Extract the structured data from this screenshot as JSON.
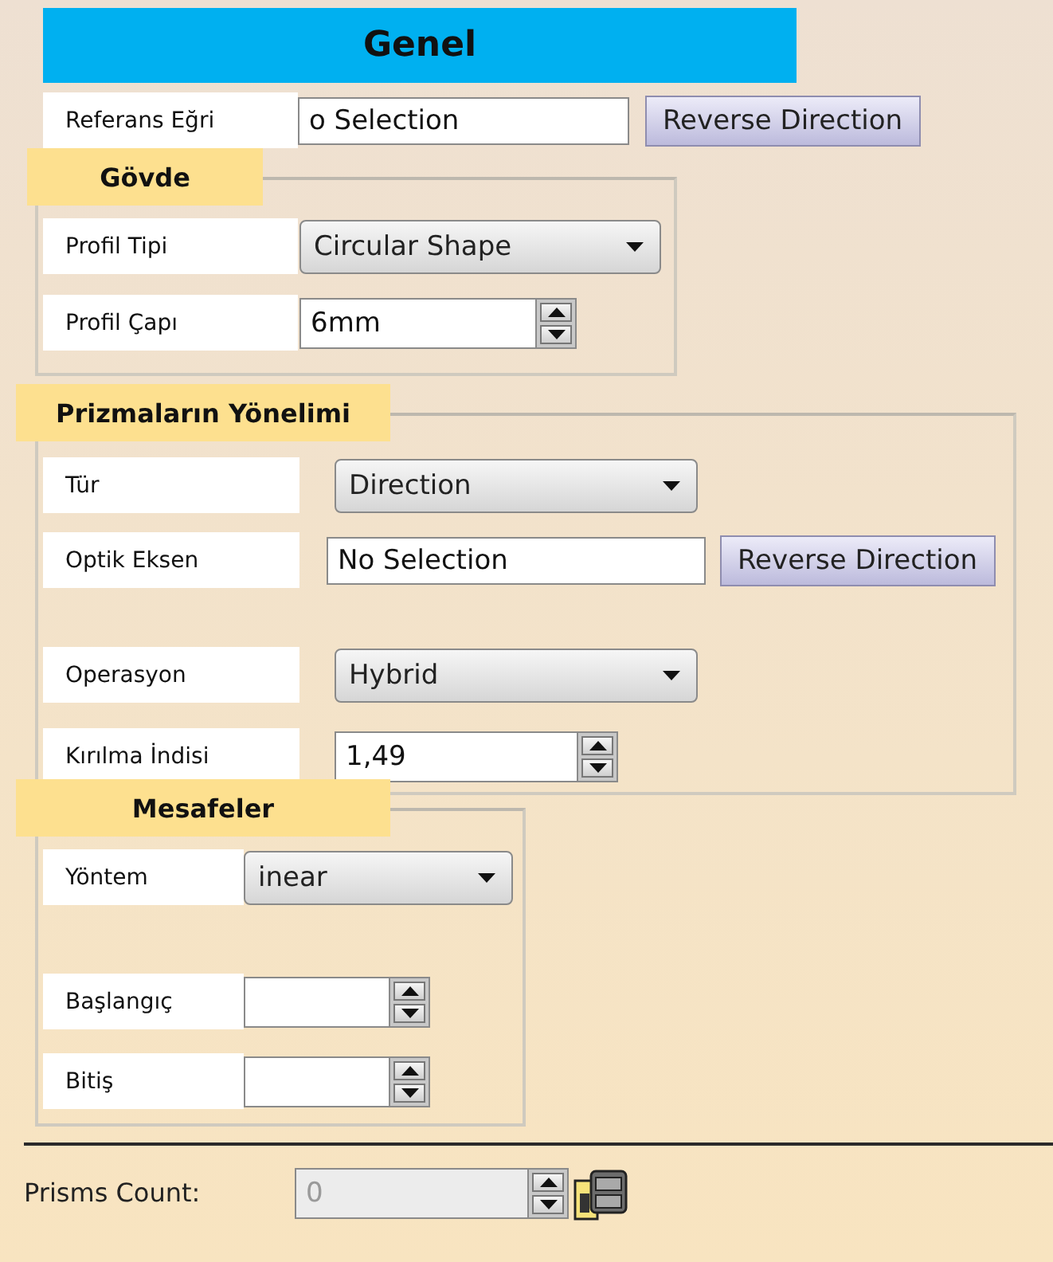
{
  "header": {
    "title": "Genel"
  },
  "reference": {
    "label": "Referans Eğri",
    "value": "o Selection",
    "button": "Reverse Direction"
  },
  "sections": [
    {
      "title": "Gövde",
      "rows": [
        {
          "kind": "dropdown",
          "label": "Profil Tipi",
          "value": "Circular Shape"
        },
        {
          "kind": "spinner",
          "label": "Profil Çapı",
          "value": "6mm"
        }
      ]
    },
    {
      "title": "Prizmaların Yönelimi",
      "rows": [
        {
          "kind": "dropdown",
          "label": "Tür",
          "value": "Direction"
        },
        {
          "kind": "field_button",
          "label": "Optik Eksen",
          "value": "No Selection",
          "button": "Reverse Direction"
        },
        {
          "kind": "dropdown",
          "label": "Operasyon",
          "value": "Hybrid"
        },
        {
          "kind": "spinner",
          "label": "Kırılma İndisi",
          "value": "1,49"
        }
      ]
    },
    {
      "title": "Mesafeler",
      "rows": [
        {
          "kind": "dropdown",
          "label": "Yöntem",
          "value": "inear"
        },
        {
          "kind": "spinner",
          "label": "Başlangıç"
        },
        {
          "kind": "spinner",
          "label": "Bitiş"
        }
      ]
    }
  ],
  "footer": {
    "label": "Prisms Count:",
    "value": "0",
    "disabled": true
  }
}
